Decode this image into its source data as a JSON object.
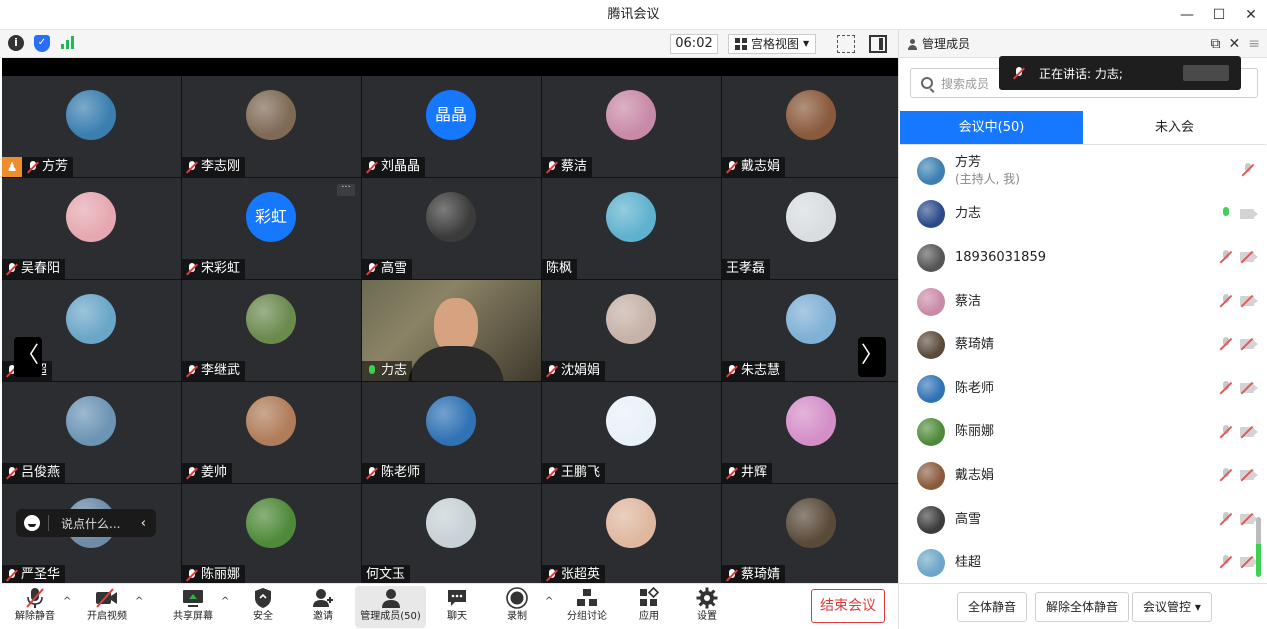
{
  "window": {
    "title": "腾讯会议",
    "controls": [
      "—",
      "☐",
      "✕"
    ]
  },
  "topbar": {
    "timer": "06:02",
    "view_label": "宫格视图"
  },
  "tiles": [
    {
      "name": "方芳",
      "mic": "muted",
      "host": true,
      "avatar_color": "#3a7fb0"
    },
    {
      "name": "李志刚",
      "mic": "muted",
      "avatar_color": "#7e6a55"
    },
    {
      "name": "刘晶晶",
      "mic": "muted",
      "avatar_text": "晶晶"
    },
    {
      "name": "蔡洁",
      "mic": "muted",
      "avatar_color": "#c98aa8"
    },
    {
      "name": "戴志娟",
      "mic": "muted",
      "avatar_color": "#8a5a3c"
    },
    {
      "name": "吴春阳",
      "mic": "muted",
      "avatar_color": "#e6a8b0"
    },
    {
      "name": "宋彩虹",
      "mic": "muted",
      "avatar_text": "彩虹",
      "more": "···"
    },
    {
      "name": "高雪",
      "mic": "muted",
      "avatar_color": "#3b3b3b"
    },
    {
      "name": "陈枫",
      "mic": "none",
      "avatar_color": "#5fb2cf"
    },
    {
      "name": "王孝磊",
      "mic": "none",
      "avatar_color": "#d9dde0"
    },
    {
      "name": "桂超",
      "mic": "muted",
      "avatar_color": "#6aa6c8"
    },
    {
      "name": "李继武",
      "mic": "muted",
      "avatar_color": "#6b8a4e"
    },
    {
      "name": "力志",
      "mic": "on",
      "video": true
    },
    {
      "name": "沈娟娟",
      "mic": "muted",
      "avatar_color": "#c6b2a8"
    },
    {
      "name": "朱志慧",
      "mic": "muted",
      "avatar_color": "#7fb0d6"
    },
    {
      "name": "吕俊燕",
      "mic": "muted",
      "avatar_color": "#6c95b5"
    },
    {
      "name": "姜帅",
      "mic": "muted",
      "avatar_color": "#b07d5a"
    },
    {
      "name": "陈老师",
      "mic": "muted",
      "avatar_color": "#2f72b5"
    },
    {
      "name": "王鹏飞",
      "mic": "muted",
      "avatar_color": "#e9f1f8"
    },
    {
      "name": "井辉",
      "mic": "muted",
      "avatar_color": "#d58fc8"
    },
    {
      "name": "严圣华",
      "mic": "muted",
      "avatar_color": "#6e8ba8"
    },
    {
      "name": "陈丽娜",
      "mic": "muted",
      "avatar_color": "#4f8a3a"
    },
    {
      "name": "何文玉",
      "mic": "none",
      "avatar_color": "#c7d1d6"
    },
    {
      "name": "张超英",
      "mic": "muted",
      "avatar_color": "#e0b8a0"
    },
    {
      "name": "蔡琦婧",
      "mic": "muted",
      "avatar_color": "#5a4a3a"
    }
  ],
  "pager": {
    "prev": "〈",
    "next": "〉"
  },
  "chat": {
    "placeholder": "说点什么...",
    "collapse": "‹"
  },
  "toolbar": {
    "unmute": "解除静音",
    "start_video": "开启视频",
    "share_screen": "共享屏幕",
    "security": "安全",
    "invite": "邀请",
    "manage_members": "管理成员(50)",
    "chat": "聊天",
    "record": "录制",
    "breakout": "分组讨论",
    "apps": "应用",
    "settings": "设置",
    "end_meeting": "结束会议",
    "caret": "^"
  },
  "panel": {
    "title": "管理成员",
    "speaking": "正在讲话: 力志;",
    "search_placeholder": "搜索成员",
    "tab_in_meeting": "会议中(50)",
    "tab_not_joined": "未入会",
    "members": [
      {
        "name": "方芳",
        "role": "(主持人, 我)",
        "avatar_color": "#3a7fb0",
        "mic": "muted",
        "cam": "none"
      },
      {
        "name": "力志",
        "avatar_color": "#2a4a8a",
        "mic": "on",
        "cam": "on"
      },
      {
        "name": "18936031859",
        "avatar_color": "#555555",
        "mic": "muted",
        "cam": "off"
      },
      {
        "name": "蔡洁",
        "avatar_color": "#c98aa8",
        "mic": "muted",
        "cam": "off"
      },
      {
        "name": "蔡琦婧",
        "avatar_color": "#5a4a3a",
        "mic": "muted",
        "cam": "off"
      },
      {
        "name": "陈老师",
        "avatar_color": "#2f72b5",
        "mic": "muted",
        "cam": "off"
      },
      {
        "name": "陈丽娜",
        "avatar_color": "#4f8a3a",
        "mic": "muted",
        "cam": "off"
      },
      {
        "name": "戴志娟",
        "avatar_color": "#8a5a3c",
        "mic": "muted",
        "cam": "off"
      },
      {
        "name": "高雪",
        "avatar_color": "#3b3b3b",
        "mic": "muted",
        "cam": "off"
      },
      {
        "name": "桂超",
        "avatar_color": "#6aa6c8",
        "mic": "muted",
        "cam": "off"
      }
    ],
    "mute_all": "全体静音",
    "unmute_all": "解除全体静音",
    "meeting_control": "会议管控 ▾"
  },
  "colors": {
    "accent": "#1677ff",
    "danger": "#e23b3b",
    "active_green": "#2fb34a",
    "host_badge": "#f08c2b"
  }
}
